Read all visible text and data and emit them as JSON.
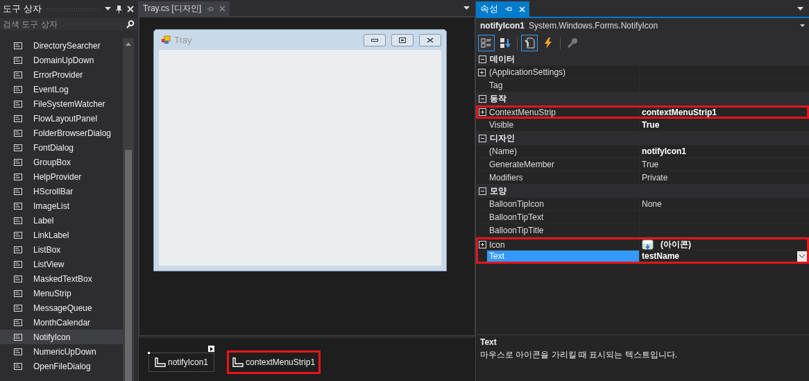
{
  "toolbox": {
    "title": "도구 상자",
    "search": {
      "placeholder": "검색 도구 상자"
    },
    "items": [
      {
        "label": "DirectorySearcher",
        "selected": false
      },
      {
        "label": "DomainUpDown",
        "selected": false
      },
      {
        "label": "ErrorProvider",
        "selected": false
      },
      {
        "label": "EventLog",
        "selected": false
      },
      {
        "label": "FileSystemWatcher",
        "selected": false
      },
      {
        "label": "FlowLayoutPanel",
        "selected": false
      },
      {
        "label": "FolderBrowserDialog",
        "selected": false
      },
      {
        "label": "FontDialog",
        "selected": false
      },
      {
        "label": "GroupBox",
        "selected": false
      },
      {
        "label": "HelpProvider",
        "selected": false
      },
      {
        "label": "HScrollBar",
        "selected": false
      },
      {
        "label": "ImageList",
        "selected": false
      },
      {
        "label": "Label",
        "selected": false
      },
      {
        "label": "LinkLabel",
        "selected": false
      },
      {
        "label": "ListBox",
        "selected": false
      },
      {
        "label": "ListView",
        "selected": false
      },
      {
        "label": "MaskedTextBox",
        "selected": false
      },
      {
        "label": "MenuStrip",
        "selected": false
      },
      {
        "label": "MessageQueue",
        "selected": false
      },
      {
        "label": "MonthCalendar",
        "selected": false
      },
      {
        "label": "NotifyIcon",
        "selected": true
      },
      {
        "label": "NumericUpDown",
        "selected": false
      },
      {
        "label": "OpenFileDialog",
        "selected": false
      }
    ]
  },
  "designer": {
    "tab": {
      "title": "Tray.cs [디자인]",
      "selected": true
    },
    "form": {
      "title": "Tray"
    },
    "tray": [
      {
        "label": "notifyIcon1",
        "selected": true,
        "highlighted": false
      },
      {
        "label": "contextMenuStrip1",
        "selected": false,
        "highlighted": true
      }
    ]
  },
  "properties": {
    "tab": {
      "title": "속성",
      "selected": true
    },
    "object_name": "notifyIcon1",
    "object_type": "System.Windows.Forms.NotifyIcon",
    "toolbar": [
      {
        "kind": "categorized",
        "selected": true
      },
      {
        "kind": "alphabetical",
        "selected": false
      },
      {
        "kind": "properties",
        "selected": true
      },
      {
        "kind": "events",
        "selected": false
      },
      {
        "kind": "pages",
        "selected": false
      }
    ],
    "groups": [
      {
        "name": "데이터",
        "expanded": true,
        "rows": [
          {
            "name": "(ApplicationSettings)",
            "expandable": true,
            "selected": false,
            "highlighted": false
          },
          {
            "name": "Tag",
            "expandable": false,
            "selected": false,
            "highlighted": false
          }
        ]
      },
      {
        "name": "동작",
        "expanded": true,
        "rows": [
          {
            "name": "ContextMenuStrip",
            "value": "contextMenuStrip1",
            "expandable": true,
            "non_default": true,
            "selected": false,
            "highlighted": true
          },
          {
            "name": "Visible",
            "value": "True",
            "expandable": false,
            "non_default": true,
            "selected": false,
            "highlighted": false
          }
        ]
      },
      {
        "name": "디자인",
        "expanded": true,
        "rows": [
          {
            "name": "(Name)",
            "value": "notifyIcon1",
            "expandable": false,
            "non_default": true,
            "selected": false,
            "highlighted": false
          },
          {
            "name": "GenerateMember",
            "value": "True",
            "expandable": false,
            "non_default": false,
            "selected": false,
            "highlighted": false
          },
          {
            "name": "Modifiers",
            "value": "Private",
            "expandable": false,
            "non_default": false,
            "selected": false,
            "highlighted": false
          }
        ]
      },
      {
        "name": "모양",
        "expanded": true,
        "rows": [
          {
            "name": "BalloonTipIcon",
            "value": "None",
            "expandable": false,
            "non_default": false,
            "selected": false,
            "highlighted": false
          },
          {
            "name": "BalloonTipText",
            "expandable": false,
            "selected": false,
            "highlighted": false
          },
          {
            "name": "BalloonTipTitle",
            "expandable": false,
            "selected": false,
            "highlighted": false
          },
          {
            "name": "Icon",
            "value": "(아이콘)",
            "kind": "icon",
            "expandable": true,
            "non_default": true,
            "selected": false,
            "highlighted": true
          },
          {
            "name": "Text",
            "value": "testName",
            "expandable": false,
            "non_default": true,
            "selected": true,
            "highlighted": true
          }
        ]
      }
    ],
    "description": {
      "title": "Text",
      "text": "마우스로 아이콘을 가리킬 때 표시되는 텍스트입니다."
    }
  }
}
